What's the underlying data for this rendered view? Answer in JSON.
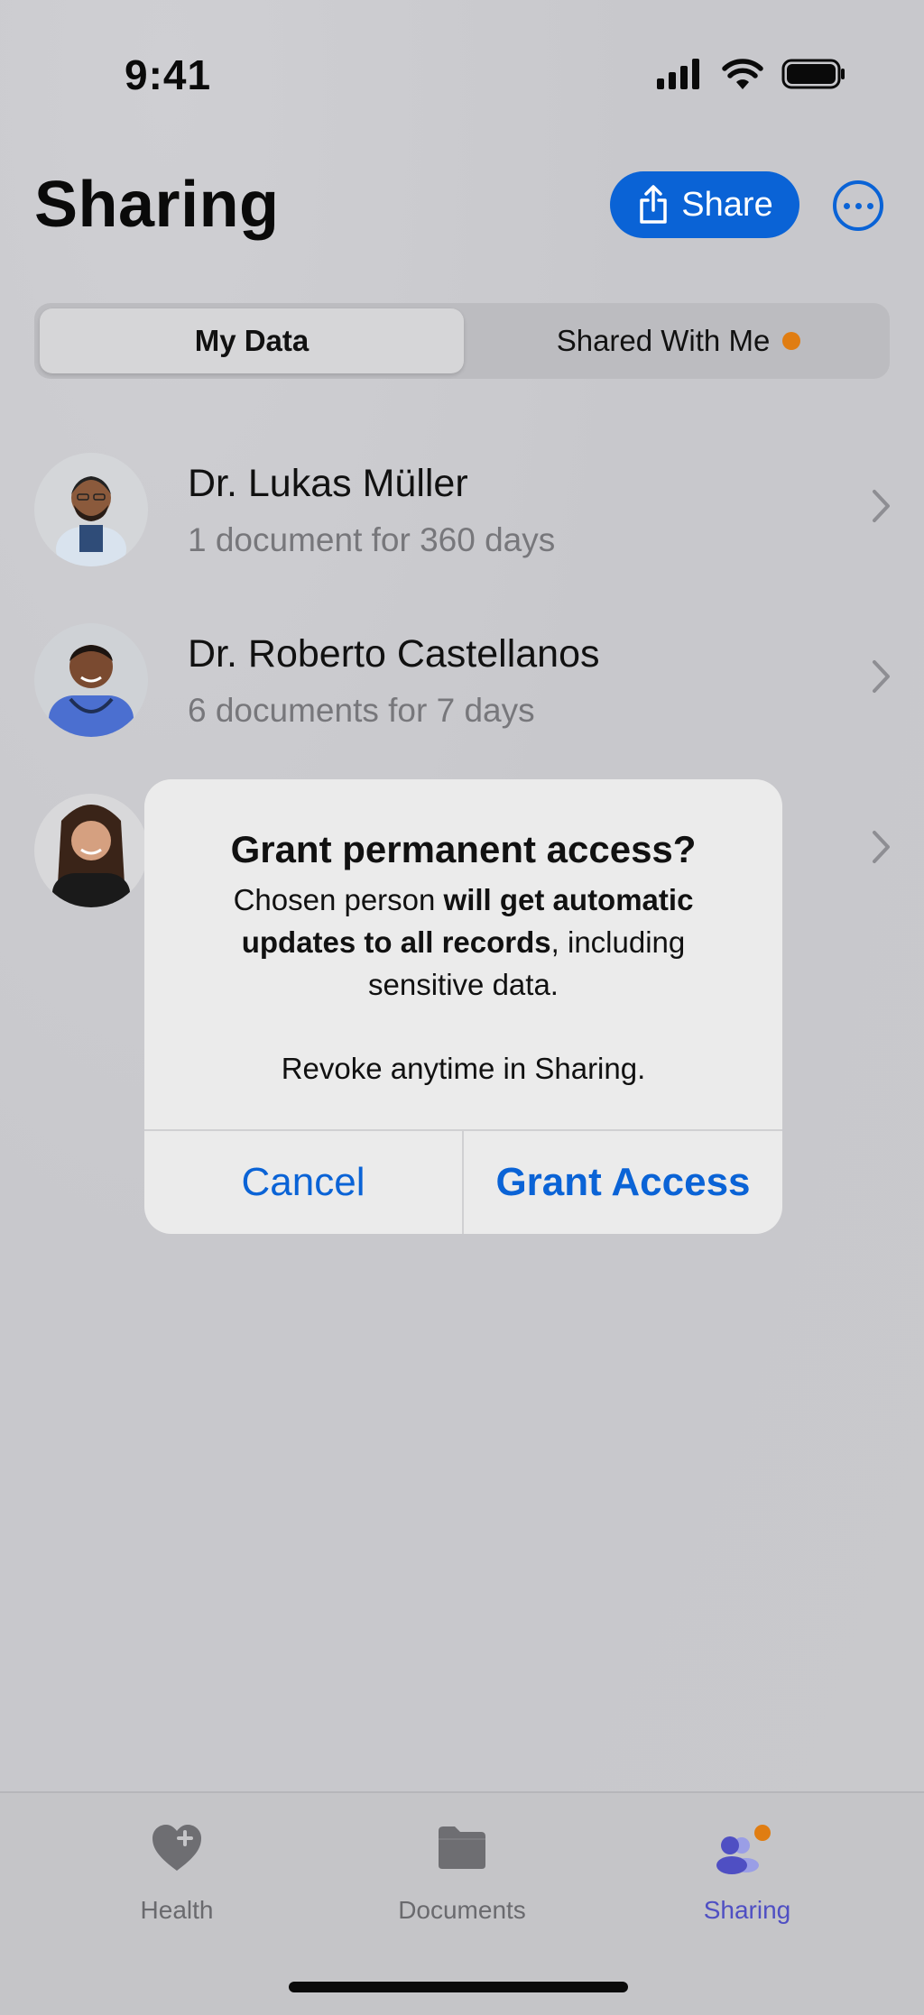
{
  "status_bar": {
    "time": "9:41"
  },
  "header": {
    "title": "Sharing",
    "share_label": "Share"
  },
  "segments": {
    "my_data": "My Data",
    "shared_with_me": "Shared With Me"
  },
  "contacts": [
    {
      "name": "Dr. Lukas Müller",
      "subtitle": "1 document for 360 days"
    },
    {
      "name": "Dr. Roberto Castellanos",
      "subtitle": "6 documents for 7 days"
    },
    {
      "name": "",
      "subtitle": ""
    }
  ],
  "dialog": {
    "title": "Grant permanent access?",
    "body_pre": "Chosen person ",
    "body_bold": "will get automatic updates to all records",
    "body_post": ", including sensitive data.",
    "note": "Revoke anytime in Sharing.",
    "cancel_label": "Cancel",
    "grant_label": "Grant Access"
  },
  "tabs": [
    {
      "label": "Health",
      "icon": "heart-plus-icon"
    },
    {
      "label": "Documents",
      "icon": "folder-icon"
    },
    {
      "label": "Sharing",
      "icon": "people-icon",
      "active": true
    }
  ],
  "colors": {
    "accent": "#0a63d6",
    "badge": "#e07d12",
    "tab_active": "#4f4fc3"
  }
}
